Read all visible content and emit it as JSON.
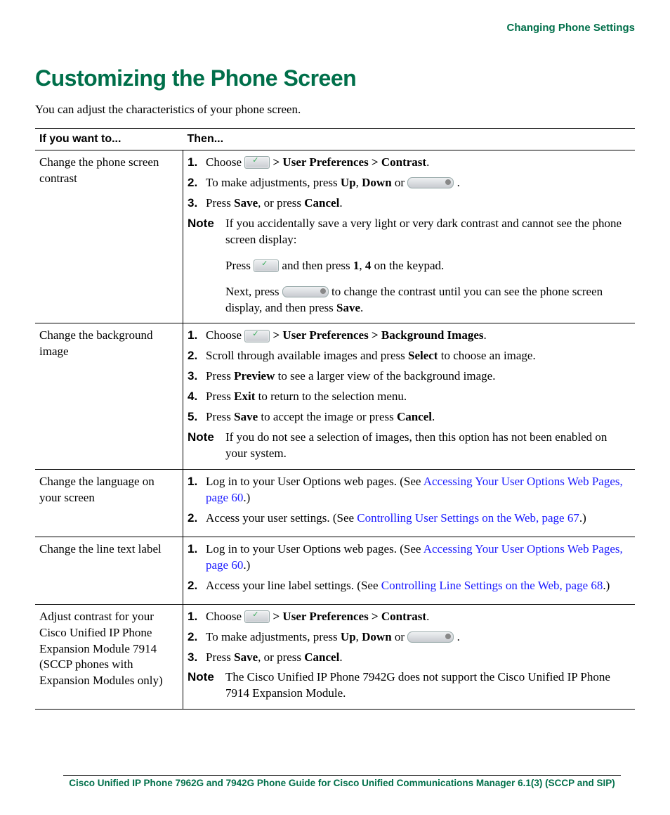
{
  "header": {
    "section": "Changing Phone Settings"
  },
  "title": "Customizing the Phone Screen",
  "intro": "You can adjust the characteristics of your phone screen.",
  "columns": {
    "left": "If you want to...",
    "right": "Then..."
  },
  "rows": {
    "r1": {
      "left": "Change the phone screen contrast",
      "s1": {
        "a": "Choose ",
        "b": " > User Preferences > Contrast",
        "c": "."
      },
      "s2": {
        "a": "To make adjustments, press ",
        "b": "Up",
        "c": ", ",
        "d": "Down",
        "e": " or ",
        "f": " ."
      },
      "s3": {
        "a": "Press ",
        "b": "Save",
        "c": ", or press ",
        "d": "Cancel",
        "e": "."
      },
      "note": {
        "label": "Note",
        "p1": "If you accidentally save a very light or very dark contrast and cannot see the phone screen display:",
        "p2a": "Press ",
        "p2b": " and then press ",
        "p2c": "1",
        "p2d": ", ",
        "p2e": "4",
        "p2f": " on the keypad.",
        "p3a": "Next, press ",
        "p3b": " to change the contrast until you can see the phone screen display, and then press ",
        "p3c": "Save",
        "p3d": "."
      }
    },
    "r2": {
      "left": "Change the background image",
      "s1": {
        "a": "Choose ",
        "b": " > User Preferences > Background Images",
        "c": "."
      },
      "s2": {
        "a": "Scroll through available images and press ",
        "b": "Select",
        "c": " to choose an image."
      },
      "s3": {
        "a": "Press ",
        "b": "Preview",
        "c": " to see a larger view of the background image."
      },
      "s4": {
        "a": "Press ",
        "b": "Exit",
        "c": " to return to the selection menu."
      },
      "s5": {
        "a": "Press ",
        "b": "Save",
        "c": " to accept the image or press ",
        "d": "Cancel",
        "e": "."
      },
      "note": {
        "label": "Note",
        "p1": "If you do not see a selection of images, then this option has not been enabled on your system."
      }
    },
    "r3": {
      "left": "Change the language on your screen",
      "s1": {
        "a": "Log in to your User Options web pages. (See ",
        "link": "Accessing Your User Options Web Pages, page 60",
        "b": ".)"
      },
      "s2": {
        "a": "Access your user settings. (See ",
        "link": "Controlling User Settings on the Web, page 67",
        "b": ".)"
      }
    },
    "r4": {
      "left": "Change the line text label",
      "s1": {
        "a": "Log in to your User Options web pages. (See ",
        "link": "Accessing Your User Options Web Pages, page 60",
        "b": ".)"
      },
      "s2": {
        "a": "Access your line label settings. (See ",
        "link": "Controlling Line Settings on the Web, page 68",
        "b": ".)"
      }
    },
    "r5": {
      "left": "Adjust contrast for your Cisco Unified IP Phone Expansion Module 7914 (SCCP phones with Expansion Modules only)",
      "s1": {
        "a": "Choose ",
        "b": " > User Preferences > Contrast",
        "c": "."
      },
      "s2": {
        "a": "To make adjustments, press ",
        "b": "Up",
        "c": ", ",
        "d": "Down",
        "e": " or ",
        "f": " ."
      },
      "s3": {
        "a": "Press ",
        "b": "Save",
        "c": ", or press ",
        "d": "Cancel",
        "e": "."
      },
      "note": {
        "label": "Note",
        "p1": "The Cisco Unified IP Phone 7942G does not support the Cisco Unified IP Phone 7914 Expansion Module."
      }
    }
  },
  "nums": {
    "n1": "1.",
    "n2": "2.",
    "n3": "3.",
    "n4": "4.",
    "n5": "5."
  },
  "footer": "Cisco Unified IP Phone 7962G and 7942G Phone Guide for Cisco Unified Communications Manager 6.1(3) (SCCP and SIP)"
}
